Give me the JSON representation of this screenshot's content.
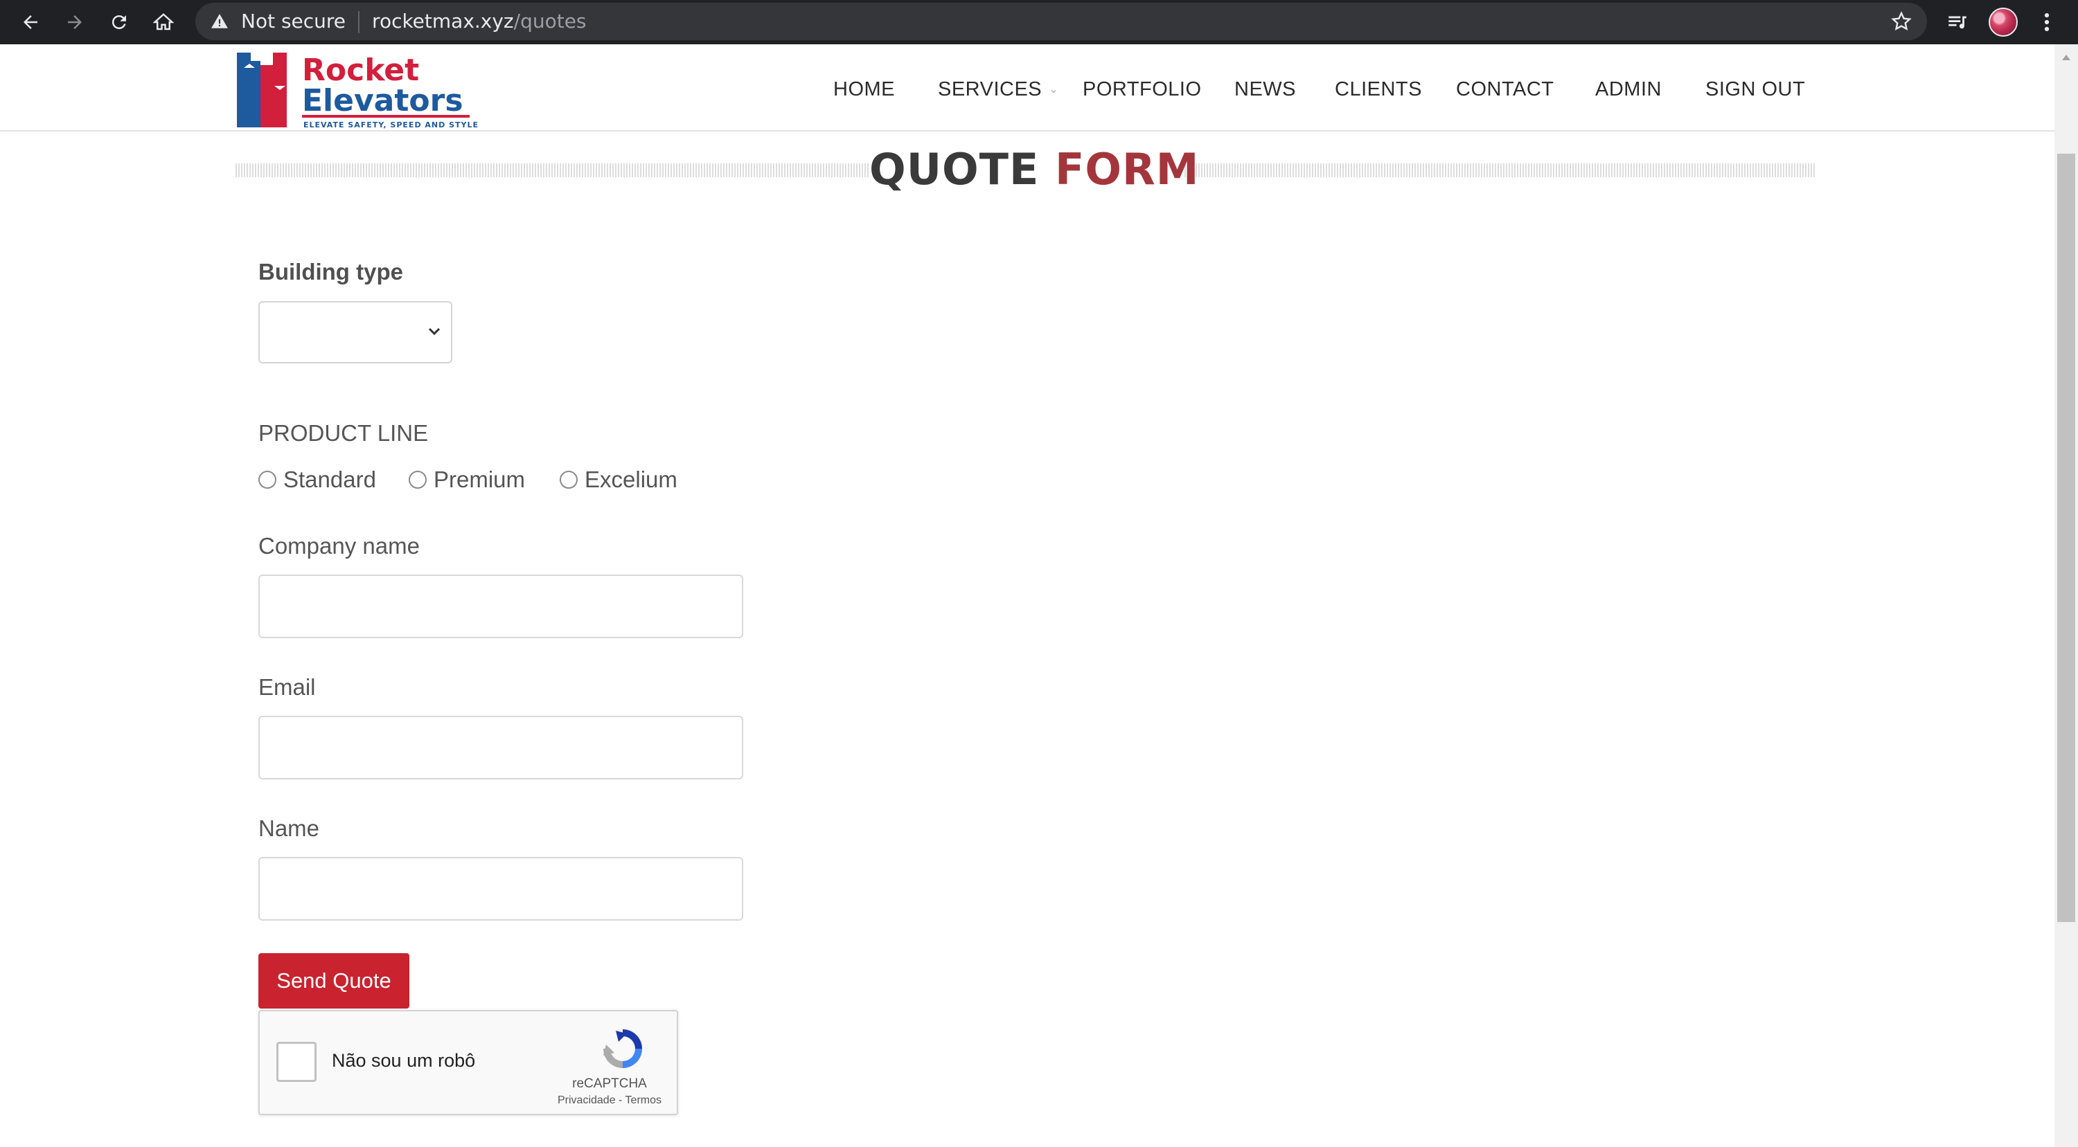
{
  "browser": {
    "security_label": "Not secure",
    "url_domain": "rocketmax.xyz",
    "url_path": "/quotes"
  },
  "header": {
    "logo": {
      "line1": "Rocket",
      "line2": "Elevators",
      "tagline": "ELEVATE SAFETY, SPEED AND STYLE"
    },
    "menu": [
      {
        "label": "HOME"
      },
      {
        "label": "SERVICES",
        "has_dropdown": true
      },
      {
        "label": "PORTFOLIO"
      },
      {
        "label": "NEWS"
      },
      {
        "label": "CLIENTS"
      },
      {
        "label": "CONTACT"
      },
      {
        "label": "ADMIN"
      },
      {
        "label": "SIGN OUT"
      }
    ]
  },
  "page": {
    "title_main": "QUOTE",
    "title_accent": "FORM"
  },
  "form": {
    "building_type_label": "Building type",
    "building_type_value": "",
    "product_line_label": "PRODUCT LINE",
    "product_options": [
      "Standard",
      "Premium",
      "Excelium"
    ],
    "company_label": "Company name",
    "company_value": "",
    "email_label": "Email",
    "email_value": "",
    "name_label": "Name",
    "name_value": "",
    "submit_label": "Send Quote"
  },
  "captcha": {
    "label": "Não sou um robô",
    "brand": "reCAPTCHA",
    "privacy": "Privacidade",
    "separator": " - ",
    "terms": "Termos"
  },
  "colors": {
    "accent_red": "#a3363c",
    "button_red": "#c8232f",
    "logo_blue": "#1d5a9e"
  }
}
